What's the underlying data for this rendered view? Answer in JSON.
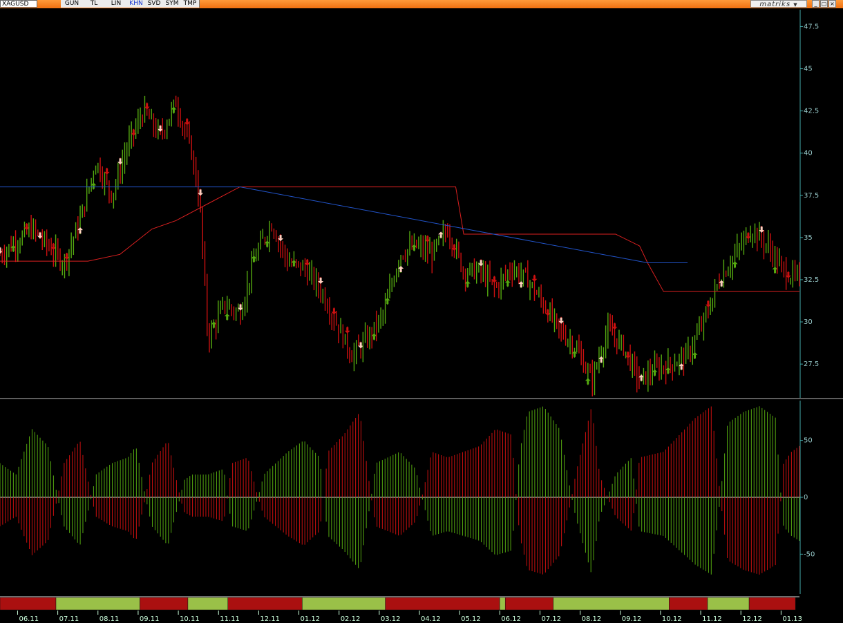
{
  "toolbar": {
    "symbol": "XAGUSD",
    "buttons": [
      "GUN",
      "TL",
      "LIN",
      "KHN",
      "SVD",
      "SYM",
      "TMP"
    ],
    "active_button": "KHN",
    "brand": "matriks",
    "brand_dropdown": "▼",
    "window_buttons": [
      "_",
      "▢",
      "×"
    ]
  },
  "colors": {
    "up": "#55aa10",
    "down": "#cc1010",
    "arrow": "#ffd0c0",
    "stop_line": "#dd2020",
    "blue_line": "#2255cc",
    "axis": "#4aa",
    "strip_red": "#aa1010",
    "strip_green": "#9ac048"
  },
  "chart_data": [
    {
      "type": "line",
      "name": "price",
      "ylim": [
        25.5,
        48.5
      ],
      "y_ticks": [
        27.5,
        30,
        32.5,
        35,
        37.5,
        40,
        42.5,
        45,
        47.5
      ],
      "x_ticks": [
        "06.11",
        "07.11",
        "08.11",
        "09.11",
        "10.11",
        "11.11",
        "12.11",
        "01.12",
        "02.12",
        "03.12",
        "04.12",
        "05.12",
        "06.12",
        "07.12",
        "08.12",
        "09.12",
        "10.12",
        "11.12",
        "12.12",
        "01.13"
      ],
      "anchors": [
        [
          0,
          34
        ],
        [
          0.04,
          35.5
        ],
        [
          0.06,
          34.5
        ],
        [
          0.08,
          33.5
        ],
        [
          0.1,
          36
        ],
        [
          0.12,
          39.5
        ],
        [
          0.14,
          37.5
        ],
        [
          0.16,
          40.5
        ],
        [
          0.18,
          42.5
        ],
        [
          0.2,
          41
        ],
        [
          0.22,
          43
        ],
        [
          0.24,
          40
        ],
        [
          0.25,
          37
        ],
        [
          0.26,
          29
        ],
        [
          0.28,
          31
        ],
        [
          0.3,
          30.5
        ],
        [
          0.32,
          34
        ],
        [
          0.34,
          35.8
        ],
        [
          0.36,
          33.5
        ],
        [
          0.38,
          33.2
        ],
        [
          0.4,
          32
        ],
        [
          0.42,
          30
        ],
        [
          0.44,
          28
        ],
        [
          0.46,
          29
        ],
        [
          0.48,
          30.5
        ],
        [
          0.5,
          34
        ],
        [
          0.52,
          34.5
        ],
        [
          0.54,
          34
        ],
        [
          0.56,
          35.5
        ],
        [
          0.58,
          33
        ],
        [
          0.6,
          33
        ],
        [
          0.62,
          32
        ],
        [
          0.64,
          33.2
        ],
        [
          0.66,
          32.5
        ],
        [
          0.68,
          31
        ],
        [
          0.7,
          29.5
        ],
        [
          0.72,
          28.5
        ],
        [
          0.74,
          26.5
        ],
        [
          0.76,
          29.5
        ],
        [
          0.78,
          28.5
        ],
        [
          0.8,
          26.5
        ],
        [
          0.82,
          27.2
        ],
        [
          0.84,
          27.5
        ],
        [
          0.86,
          28
        ],
        [
          0.88,
          30
        ],
        [
          0.9,
          32.5
        ],
        [
          0.92,
          34
        ],
        [
          0.94,
          35.5
        ],
        [
          0.96,
          34.5
        ],
        [
          0.98,
          33
        ],
        [
          1,
          32.5
        ]
      ],
      "stop_line": [
        [
          0,
          33.6
        ],
        [
          0.11,
          33.6
        ],
        [
          0.15,
          34
        ],
        [
          0.19,
          35.5
        ],
        [
          0.22,
          36
        ],
        [
          0.26,
          37
        ],
        [
          0.3,
          38
        ],
        [
          0.57,
          38
        ],
        [
          0.58,
          35.2
        ],
        [
          0.77,
          35.2
        ],
        [
          0.8,
          34.5
        ],
        [
          0.81,
          33.5
        ],
        [
          0.83,
          31.8
        ],
        [
          1,
          31.8
        ]
      ],
      "blue_line": [
        [
          0,
          38
        ],
        [
          0.3,
          38
        ],
        [
          0.81,
          33.5
        ],
        [
          0.86,
          33.5
        ]
      ]
    },
    {
      "type": "bar",
      "name": "oscillator",
      "ylim": [
        -85,
        85
      ],
      "y_ticks": [
        -50,
        0,
        50
      ],
      "anchors": [
        [
          0,
          30
        ],
        [
          0.02,
          20
        ],
        [
          0.04,
          60
        ],
        [
          0.06,
          45
        ],
        [
          0.08,
          -30
        ],
        [
          0.1,
          -50
        ],
        [
          0.12,
          20
        ],
        [
          0.14,
          30
        ],
        [
          0.16,
          35
        ],
        [
          0.17,
          45
        ],
        [
          0.19,
          -30
        ],
        [
          0.21,
          -50
        ],
        [
          0.23,
          15
        ],
        [
          0.24,
          20
        ],
        [
          0.26,
          20
        ],
        [
          0.28,
          25
        ],
        [
          0.29,
          -30
        ],
        [
          0.31,
          -35
        ],
        [
          0.33,
          20
        ],
        [
          0.36,
          40
        ],
        [
          0.38,
          50
        ],
        [
          0.4,
          35
        ],
        [
          0.41,
          -40
        ],
        [
          0.43,
          -55
        ],
        [
          0.45,
          -75
        ],
        [
          0.47,
          30
        ],
        [
          0.5,
          40
        ],
        [
          0.52,
          25
        ],
        [
          0.54,
          -40
        ],
        [
          0.56,
          -35
        ],
        [
          0.58,
          -40
        ],
        [
          0.6,
          -45
        ],
        [
          0.62,
          -60
        ],
        [
          0.64,
          -55
        ],
        [
          0.65,
          40
        ],
        [
          0.66,
          75
        ],
        [
          0.68,
          80
        ],
        [
          0.7,
          60
        ],
        [
          0.72,
          -20
        ],
        [
          0.74,
          -80
        ],
        [
          0.75,
          -20
        ],
        [
          0.77,
          20
        ],
        [
          0.79,
          35
        ],
        [
          0.8,
          -35
        ],
        [
          0.83,
          -40
        ],
        [
          0.85,
          -55
        ],
        [
          0.87,
          -70
        ],
        [
          0.89,
          -80
        ],
        [
          0.91,
          65
        ],
        [
          0.93,
          75
        ],
        [
          0.95,
          80
        ],
        [
          0.97,
          70
        ],
        [
          0.98,
          -30
        ],
        [
          0.99,
          -40
        ],
        [
          1,
          -45
        ]
      ]
    }
  ]
}
